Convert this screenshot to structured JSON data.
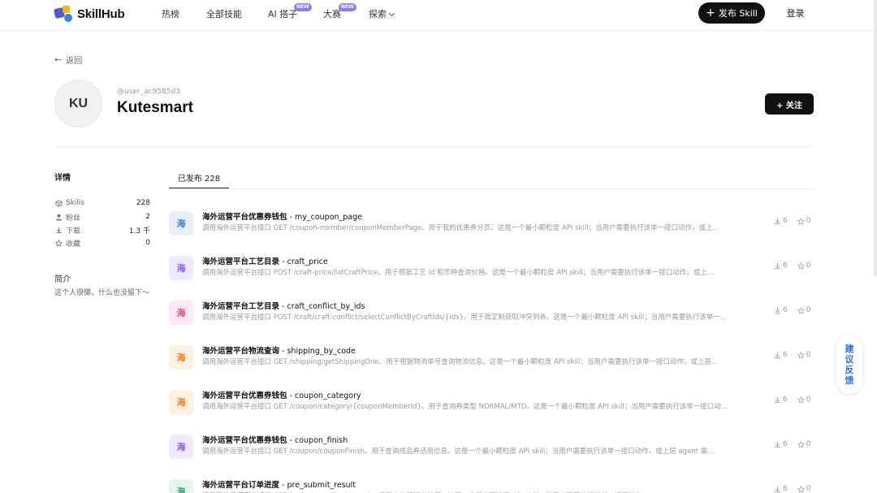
{
  "topbar": {
    "logo_text": "SkillHub",
    "nav": [
      {
        "label": "热榜",
        "badge": ""
      },
      {
        "label": "全部技能",
        "badge": ""
      },
      {
        "label": "AI 搭子",
        "badge": "NEW"
      },
      {
        "label": "大赛",
        "badge": "NEW"
      },
      {
        "label": "探索",
        "badge": ""
      }
    ],
    "publish_label": "发布 Skill",
    "login_label": "登录"
  },
  "back_label": "返回",
  "profile": {
    "avatar_initials": "KU",
    "handle": "@user_ac9585d3",
    "name": "Kutesmart",
    "follow_label": "+ 关注"
  },
  "details": {
    "title": "详情",
    "stats": [
      {
        "icon": "cube-icon",
        "label": "Skills",
        "value": "228"
      },
      {
        "icon": "user-icon",
        "label": "粉丝",
        "value": "2"
      },
      {
        "icon": "download-icon",
        "label": "下载",
        "value": "1.3 千"
      },
      {
        "icon": "star-icon",
        "label": "收藏",
        "value": "0"
      }
    ],
    "intro_title": "简介",
    "intro_text": "这个人很懒，什么也没留下～"
  },
  "tabs": [
    {
      "label": "已发布 228",
      "active": true
    }
  ],
  "skills": [
    {
      "icon_char": "海",
      "color": "#3b7cf5",
      "bg": "#e6eeff",
      "title_cn": "海外运营平台优惠券钱包",
      "title_en": " - my_coupon_page",
      "desc": "调用海外运营平台接口 GET /coupon-member/couponMemberPage。用于我的优惠券分页。这是一个最小颗粒度 API skill；当用户需要执行该单一接口动作，或上...",
      "downloads": "6",
      "stars": "0"
    },
    {
      "icon_char": "海",
      "color": "#8a5cf6",
      "bg": "#f0e9ff",
      "title_cn": "海外运营平台工艺目录",
      "title_en": " - craft_price",
      "desc": "调用海外运营平台接口 POST /craft-price/listCraftPrice。用于根据工艺 id 和币种查询价格。这是一个最小颗粒度 API skill；当用户需要执行该单一接口动作，或上...",
      "downloads": "6",
      "stars": "0"
    },
    {
      "icon_char": "海",
      "color": "#e0489a",
      "bg": "#fde8f3",
      "title_cn": "海外运营平台工艺目录",
      "title_en": " - craft_conflict_by_ids",
      "desc": "调用海外运营平台接口 POST /craft/craft-conflict/selectConflictByCraftIds/{ids}。用于简定制获取冲突列表。这是一个最小颗粒度 API skill；当用户需要执行该单一...",
      "downloads": "6",
      "stars": "0"
    },
    {
      "icon_char": "海",
      "color": "#ef7d1a",
      "bg": "#fff0e0",
      "title_cn": "海外运营平台物流查询",
      "title_en": " - shipping_by_code",
      "desc": "调用海外运营平台接口 GET /shipping/getShippingOne。用于根据物流单号查询物流信息。这是一个最小颗粒度 API skill；当用户需要执行该单一接口动作，或上层...",
      "downloads": "6",
      "stars": "0"
    },
    {
      "icon_char": "海",
      "color": "#ef7d1a",
      "bg": "#fff0e0",
      "title_cn": "海外运营平台优惠券钱包",
      "title_en": " - coupon_category",
      "desc": "调用海外运营平台接口 GET /coupon/category/{couponMemberId}。用于查询券类型 NORMAL/MTO。这是一个最小颗粒度 API skill；当用户需要执行该单一接口动...",
      "downloads": "6",
      "stars": "0"
    },
    {
      "icon_char": "海",
      "color": "#8a5cf6",
      "bg": "#f0e9ff",
      "title_cn": "海外运营平台优惠券钱包",
      "title_en": " - coupon_finish",
      "desc": "调用海外运营平台接口 GET /coupon/couponFinish。用于查询成品券适用信息。这是一个最小颗粒度 API skill；当用户需要执行该单一接口动作，或上层 agent 需...",
      "downloads": "6",
      "stars": "0"
    },
    {
      "icon_char": "海",
      "color": "#21a86a",
      "bg": "#e2f7ec",
      "title_cn": "海外运营平台订单进度",
      "title_en": " - pre_submit_result",
      "desc": "调用海外运营平台接口 GET /order/pre-submit/result。用于查询预提交结果。这是一个最小颗粒度 API skill；当用户需要执行该单一接口动作...",
      "downloads": "6",
      "stars": "0"
    }
  ],
  "feedback_label": "建议反馈"
}
